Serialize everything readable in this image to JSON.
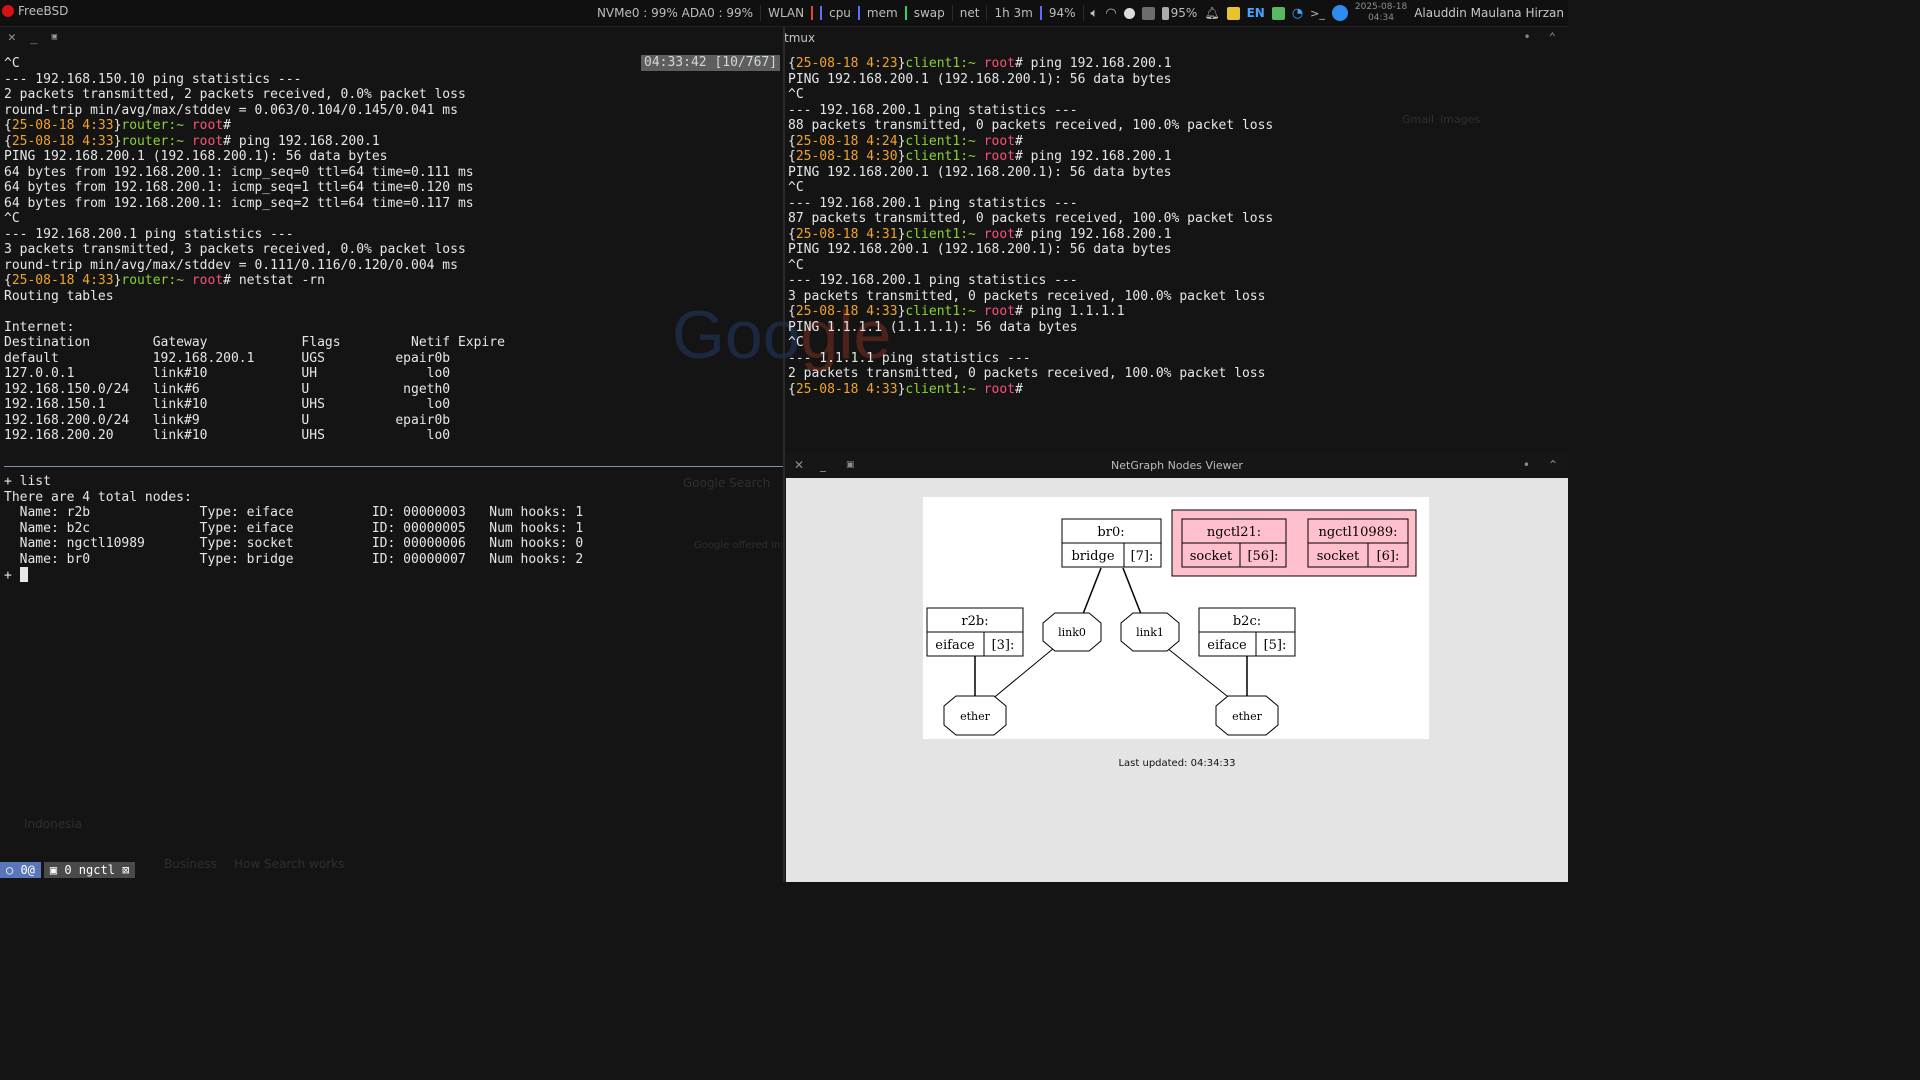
{
  "topbar": {
    "os_label": "FreeBSD",
    "disk": "NVMe0 : 99% ADA0 : 99%",
    "wlan": "WLAN",
    "cpu": "cpu",
    "mem": "mem",
    "swap": "swap",
    "net": "net",
    "uptime": "1h 3m",
    "brightness": "94%",
    "battery": "95%",
    "lang": "EN",
    "date": "2025-08-18",
    "time": "04:34",
    "user": "Alauddin Maulana Hirzan",
    "icons": [
      "volume-icon",
      "headphones-icon",
      "camera-icon",
      "monitor-icon",
      "battery-icon",
      "bell-icon",
      "notes-icon",
      "image-icon",
      "wifi-icon",
      "terminal-icon",
      "app-icon"
    ],
    "colors": {
      "bar_blue": "#5f6cff",
      "bar_red": "#e04a2b",
      "bar_green": "#2bd46a"
    }
  },
  "left_pane": {
    "status_time": "04:33:42 [10/767]",
    "lines": [
      [
        {
          "t": "^C",
          "c": "w"
        }
      ],
      [
        {
          "t": "--- 192.168.150.10 ping statistics ---",
          "c": "w"
        }
      ],
      [
        {
          "t": "2 packets transmitted, 2 packets received, 0.0% packet loss",
          "c": "w"
        }
      ],
      [
        {
          "t": "round-trip min/avg/max/stddev = 0.063/0.104/0.145/0.041 ms",
          "c": "w"
        }
      ],
      [
        {
          "t": "{",
          "c": "w"
        },
        {
          "t": "25-08-18 4:33",
          "c": "o"
        },
        {
          "t": "}",
          "c": "w"
        },
        {
          "t": "router:~ ",
          "c": "g"
        },
        {
          "t": "root",
          "c": "p"
        },
        {
          "t": "#",
          "c": "w"
        }
      ],
      [
        {
          "t": "{",
          "c": "w"
        },
        {
          "t": "25-08-18 4:33",
          "c": "o"
        },
        {
          "t": "}",
          "c": "w"
        },
        {
          "t": "router:~ ",
          "c": "g"
        },
        {
          "t": "root",
          "c": "p"
        },
        {
          "t": "# ping 192.168.200.1",
          "c": "w"
        }
      ],
      [
        {
          "t": "PING 192.168.200.1 (192.168.200.1): 56 data bytes",
          "c": "w"
        }
      ],
      [
        {
          "t": "64 bytes from 192.168.200.1: icmp_seq=0 ttl=64 time=0.111 ms",
          "c": "w"
        }
      ],
      [
        {
          "t": "64 bytes from 192.168.200.1: icmp_seq=1 ttl=64 time=0.120 ms",
          "c": "w"
        }
      ],
      [
        {
          "t": "64 bytes from 192.168.200.1: icmp_seq=2 ttl=64 time=0.117 ms",
          "c": "w"
        }
      ],
      [
        {
          "t": "^C",
          "c": "w"
        }
      ],
      [
        {
          "t": "--- 192.168.200.1 ping statistics ---",
          "c": "w"
        }
      ],
      [
        {
          "t": "3 packets transmitted, 3 packets received, 0.0% packet loss",
          "c": "w"
        }
      ],
      [
        {
          "t": "round-trip min/avg/max/stddev = 0.111/0.116/0.120/0.004 ms",
          "c": "w"
        }
      ],
      [
        {
          "t": "{",
          "c": "w"
        },
        {
          "t": "25-08-18 4:33",
          "c": "o"
        },
        {
          "t": "}",
          "c": "w"
        },
        {
          "t": "router:~ ",
          "c": "g"
        },
        {
          "t": "root",
          "c": "p"
        },
        {
          "t": "# netstat -rn",
          "c": "w"
        }
      ],
      [
        {
          "t": "Routing tables",
          "c": "w"
        }
      ],
      [
        {
          "t": "",
          "c": "w"
        }
      ],
      [
        {
          "t": "Internet:",
          "c": "w"
        }
      ],
      [
        {
          "t": "Destination        Gateway            Flags         Netif Expire",
          "c": "w"
        }
      ],
      [
        {
          "t": "default            192.168.200.1      UGS         epair0b",
          "c": "w"
        }
      ],
      [
        {
          "t": "127.0.0.1          link#10            UH              lo0",
          "c": "w"
        }
      ],
      [
        {
          "t": "192.168.150.0/24   link#6             U            ngeth0",
          "c": "w"
        }
      ],
      [
        {
          "t": "192.168.150.1      link#10            UHS             lo0",
          "c": "w"
        }
      ],
      [
        {
          "t": "192.168.200.0/24   link#9             U           epair0b",
          "c": "w"
        }
      ],
      [
        {
          "t": "192.168.200.20     link#10            UHS             lo0",
          "c": "w"
        }
      ]
    ],
    "bottom_lines": [
      "+ list",
      "There are 4 total nodes:",
      "  Name: r2b              Type: eiface          ID: 00000003   Num hooks: 1",
      "  Name: b2c              Type: eiface          ID: 00000005   Num hooks: 1",
      "  Name: ngctl10989       Type: socket          ID: 00000006   Num hooks: 0",
      "  Name: br0              Type: bridge          ID: 00000007   Num hooks: 2"
    ],
    "prompt": "+ "
  },
  "right_pane": {
    "title": "tmux",
    "lines": [
      [
        {
          "t": "{",
          "c": "w"
        },
        {
          "t": "25-08-18 4:23",
          "c": "o"
        },
        {
          "t": "}",
          "c": "w"
        },
        {
          "t": "client1:~ ",
          "c": "g"
        },
        {
          "t": "root",
          "c": "p"
        },
        {
          "t": "# ping 192.168.200.1",
          "c": "w"
        }
      ],
      [
        {
          "t": "PING 192.168.200.1 (192.168.200.1): 56 data bytes",
          "c": "w"
        }
      ],
      [
        {
          "t": "^C",
          "c": "w"
        }
      ],
      [
        {
          "t": "--- 192.168.200.1 ping statistics ---",
          "c": "w"
        }
      ],
      [
        {
          "t": "88 packets transmitted, 0 packets received, 100.0% packet loss",
          "c": "w"
        }
      ],
      [
        {
          "t": "{",
          "c": "w"
        },
        {
          "t": "25-08-18 4:24",
          "c": "o"
        },
        {
          "t": "}",
          "c": "w"
        },
        {
          "t": "client1:~ ",
          "c": "g"
        },
        {
          "t": "root",
          "c": "p"
        },
        {
          "t": "#",
          "c": "w"
        }
      ],
      [
        {
          "t": "{",
          "c": "w"
        },
        {
          "t": "25-08-18 4:30",
          "c": "o"
        },
        {
          "t": "}",
          "c": "w"
        },
        {
          "t": "client1:~ ",
          "c": "g"
        },
        {
          "t": "root",
          "c": "p"
        },
        {
          "t": "# ping 192.168.200.1",
          "c": "w"
        }
      ],
      [
        {
          "t": "PING 192.168.200.1 (192.168.200.1): 56 data bytes",
          "c": "w"
        }
      ],
      [
        {
          "t": "^C",
          "c": "w"
        }
      ],
      [
        {
          "t": "--- 192.168.200.1 ping statistics ---",
          "c": "w"
        }
      ],
      [
        {
          "t": "87 packets transmitted, 0 packets received, 100.0% packet loss",
          "c": "w"
        }
      ],
      [
        {
          "t": "{",
          "c": "w"
        },
        {
          "t": "25-08-18 4:31",
          "c": "o"
        },
        {
          "t": "}",
          "c": "w"
        },
        {
          "t": "client1:~ ",
          "c": "g"
        },
        {
          "t": "root",
          "c": "p"
        },
        {
          "t": "# ping 192.168.200.1",
          "c": "w"
        }
      ],
      [
        {
          "t": "PING 192.168.200.1 (192.168.200.1): 56 data bytes",
          "c": "w"
        }
      ],
      [
        {
          "t": "^C",
          "c": "w"
        }
      ],
      [
        {
          "t": "--- 192.168.200.1 ping statistics ---",
          "c": "w"
        }
      ],
      [
        {
          "t": "3 packets transmitted, 0 packets received, 100.0% packet loss",
          "c": "w"
        }
      ],
      [
        {
          "t": "{",
          "c": "w"
        },
        {
          "t": "25-08-18 4:33",
          "c": "o"
        },
        {
          "t": "}",
          "c": "w"
        },
        {
          "t": "client1:~ ",
          "c": "g"
        },
        {
          "t": "root",
          "c": "p"
        },
        {
          "t": "# ping 1.1.1.1",
          "c": "w"
        }
      ],
      [
        {
          "t": "PING 1.1.1.1 (1.1.1.1): 56 data bytes",
          "c": "w"
        }
      ],
      [
        {
          "t": "^C",
          "c": "w"
        }
      ],
      [
        {
          "t": "--- 1.1.1.1 ping statistics ---",
          "c": "w"
        }
      ],
      [
        {
          "t": "2 packets transmitted, 0 packets received, 100.0% packet loss",
          "c": "w"
        }
      ],
      [
        {
          "t": "{",
          "c": "w"
        },
        {
          "t": "25-08-18 4:33",
          "c": "o"
        },
        {
          "t": "}",
          "c": "w"
        },
        {
          "t": "client1:~ ",
          "c": "g"
        },
        {
          "t": "root",
          "c": "p"
        },
        {
          "t": "#",
          "c": "w"
        }
      ]
    ]
  },
  "netgraph": {
    "title": "NetGraph Nodes Viewer",
    "last_updated": "Last updated: 04:34:33",
    "nodes": {
      "br0": {
        "name": "br0:",
        "type": "bridge",
        "id": "[7]:"
      },
      "ngctl21": {
        "name": "ngctl21:",
        "type": "socket",
        "id": "[56]:"
      },
      "ngctl10989": {
        "name": "ngctl10989:",
        "type": "socket",
        "id": "[6]:"
      },
      "r2b": {
        "name": "r2b:",
        "type": "eiface",
        "id": "[3]:"
      },
      "b2c": {
        "name": "b2c:",
        "type": "eiface",
        "id": "[5]:"
      }
    },
    "hooks": {
      "link0": "link0",
      "link1": "link1",
      "ether_left": "ether",
      "ether_right": "ether"
    },
    "socket_group_color": "#ffc0cb"
  },
  "background_ghost": {
    "google_search": "Google Search",
    "google_offered": "Google offered in:",
    "gmail": "Gmail",
    "images": "Images",
    "indonesia": "Indonesia",
    "business": "Business",
    "how_search_works": "How Search works"
  },
  "tmux_status": {
    "session": "○ 0@",
    "window": "▣ 0 ngctl ⊠"
  }
}
